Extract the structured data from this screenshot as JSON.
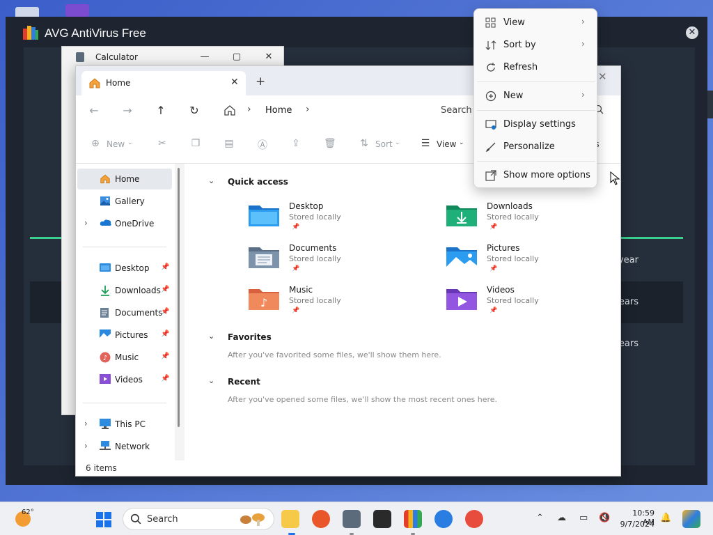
{
  "avg": {
    "title": "AVG AntiVirus Free",
    "close": "✕",
    "rows": [
      "year",
      "ears",
      "ears"
    ],
    "accent": "#3bd08f"
  },
  "calculator": {
    "title": "Calculator",
    "minimize": "—",
    "maximize": "▢",
    "close": "✕"
  },
  "explorer": {
    "tab_label": "Home",
    "tab_close": "✕",
    "new_tab": "+",
    "window_close": "✕",
    "address": {
      "path": "Home",
      "sep": "›"
    },
    "search_placeholder": "Search H",
    "toolbar": {
      "new_label": "New",
      "sort_label": "Sort",
      "view_label": "View",
      "details_label": "ls"
    },
    "sidebar": {
      "items": [
        {
          "label": "Home"
        },
        {
          "label": "Gallery"
        },
        {
          "label": "OneDrive"
        },
        {
          "label": "Desktop"
        },
        {
          "label": "Downloads"
        },
        {
          "label": "Documents"
        },
        {
          "label": "Pictures"
        },
        {
          "label": "Music"
        },
        {
          "label": "Videos"
        },
        {
          "label": "This PC"
        },
        {
          "label": "Network"
        }
      ]
    },
    "status": "6 items",
    "quick_access": {
      "title": "Quick access",
      "folders": [
        {
          "name": "Desktop",
          "sub": "Stored locally"
        },
        {
          "name": "Downloads",
          "sub": "Stored locally"
        },
        {
          "name": "Documents",
          "sub": "Stored locally"
        },
        {
          "name": "Pictures",
          "sub": "Stored locally"
        },
        {
          "name": "Music",
          "sub": "Stored locally"
        },
        {
          "name": "Videos",
          "sub": "Stored locally"
        }
      ]
    },
    "favorites": {
      "title": "Favorites",
      "message": "After you've favorited some files, we'll show them here."
    },
    "recent": {
      "title": "Recent",
      "message": "After you've opened some files, we'll show the most recent ones here."
    }
  },
  "context_menu": {
    "items": [
      {
        "label": "View",
        "icon": "grid-icon",
        "submenu": true
      },
      {
        "label": "Sort by",
        "icon": "sort-icon",
        "submenu": true
      },
      {
        "label": "Refresh",
        "icon": "refresh-icon",
        "submenu": false
      },
      {
        "label": "New",
        "icon": "plus-circle-icon",
        "submenu": true
      },
      {
        "label": "Display settings",
        "icon": "display-icon",
        "submenu": false
      },
      {
        "label": "Personalize",
        "icon": "brush-icon",
        "submenu": false
      },
      {
        "label": "Show more options",
        "icon": "expand-icon",
        "submenu": false
      }
    ],
    "arrow": "›"
  },
  "taskbar": {
    "weather_temp": "62°",
    "search_label": "Search",
    "time": "10:59 AM",
    "date": "9/7/2024"
  }
}
